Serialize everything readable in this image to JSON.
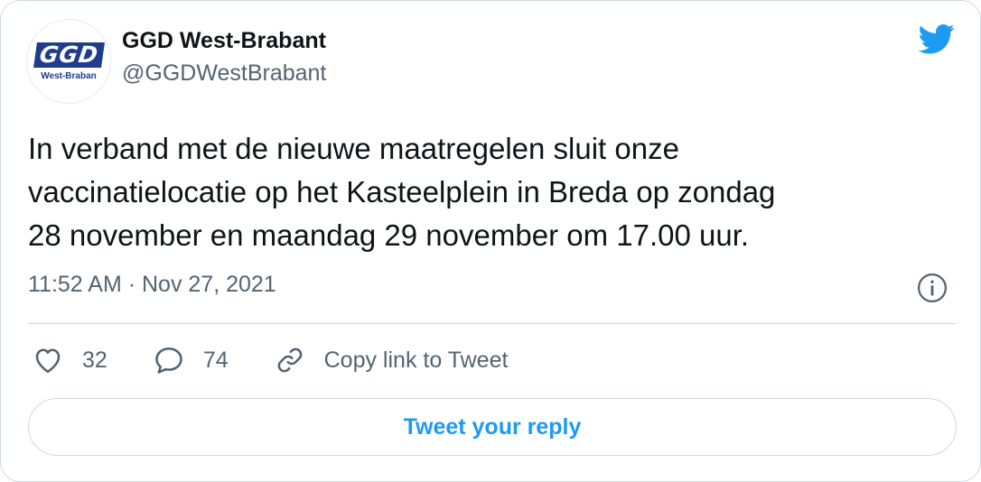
{
  "author": {
    "display_name": "GGD West-Brabant",
    "handle": "@GGDWestBrabant",
    "logo_text": "GGD",
    "logo_subtext": "West-Braban"
  },
  "tweet": {
    "text": "In verband met de nieuwe maatregelen sluit onze\nvaccinatielocatie op het Kasteelplein in Breda op zondag\n28 november en maandag 29 november om 17.00 uur.",
    "timestamp": "11:52 AM · Nov 27, 2021"
  },
  "actions": {
    "likes": "32",
    "replies": "74",
    "copy_link_label": "Copy link to Tweet"
  },
  "reply_button_label": "Tweet your reply",
  "icons": {
    "brand": "twitter-bird-icon",
    "info": "info-icon",
    "like": "heart-icon",
    "reply": "speech-bubble-icon",
    "copy": "link-icon"
  },
  "colors": {
    "accent": "#1d9bf0",
    "secondary_text": "#536471",
    "border": "#cfd9de",
    "logo_blue": "#1f3c8f"
  }
}
